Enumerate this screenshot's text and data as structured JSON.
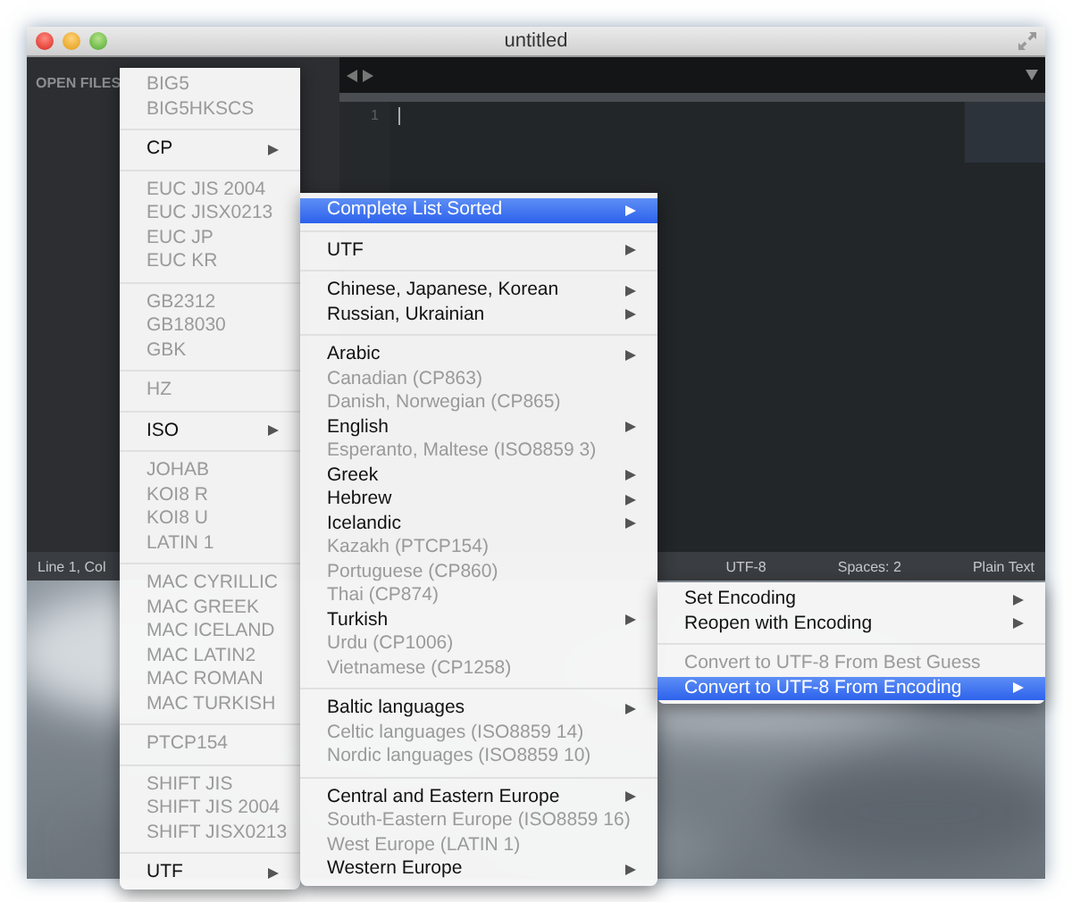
{
  "window": {
    "title": "untitled",
    "sidebar": {
      "header": "OPEN FILES"
    },
    "editor": {
      "line_numbers": [
        "1"
      ]
    },
    "status_bar": {
      "position": "Line 1, Col",
      "encoding": "UTF-8",
      "indentation": "Spaces: 2",
      "syntax": "Plain Text"
    }
  },
  "menus": [
    {
      "groups": [
        {
          "items": [
            {
              "label": "BIG5",
              "disabled": true,
              "submenu": false,
              "selected": false
            },
            {
              "label": "BIG5HKSCS",
              "disabled": true,
              "submenu": false,
              "selected": false
            }
          ]
        },
        {
          "items": [
            {
              "label": "CP",
              "disabled": false,
              "submenu": true,
              "selected": false
            }
          ]
        },
        {
          "items": [
            {
              "label": "EUC JIS 2004",
              "disabled": true,
              "submenu": false,
              "selected": false
            },
            {
              "label": "EUC JISX0213",
              "disabled": true,
              "submenu": false,
              "selected": false
            },
            {
              "label": "EUC JP",
              "disabled": true,
              "submenu": false,
              "selected": false
            },
            {
              "label": "EUC KR",
              "disabled": true,
              "submenu": false,
              "selected": false
            }
          ]
        },
        {
          "items": [
            {
              "label": "GB2312",
              "disabled": true,
              "submenu": false,
              "selected": false
            },
            {
              "label": "GB18030",
              "disabled": true,
              "submenu": false,
              "selected": false
            },
            {
              "label": "GBK",
              "disabled": true,
              "submenu": false,
              "selected": false
            }
          ]
        },
        {
          "items": [
            {
              "label": "HZ",
              "disabled": true,
              "submenu": false,
              "selected": false
            }
          ]
        },
        {
          "items": [
            {
              "label": "ISO",
              "disabled": false,
              "submenu": true,
              "selected": false
            }
          ]
        },
        {
          "items": [
            {
              "label": "JOHAB",
              "disabled": true,
              "submenu": false,
              "selected": false
            },
            {
              "label": "KOI8 R",
              "disabled": true,
              "submenu": false,
              "selected": false
            },
            {
              "label": "KOI8 U",
              "disabled": true,
              "submenu": false,
              "selected": false
            },
            {
              "label": "LATIN 1",
              "disabled": true,
              "submenu": false,
              "selected": false
            }
          ]
        },
        {
          "items": [
            {
              "label": "MAC CYRILLIC",
              "disabled": true,
              "submenu": false,
              "selected": false
            },
            {
              "label": "MAC GREEK",
              "disabled": true,
              "submenu": false,
              "selected": false
            },
            {
              "label": "MAC ICELAND",
              "disabled": true,
              "submenu": false,
              "selected": false
            },
            {
              "label": "MAC LATIN2",
              "disabled": true,
              "submenu": false,
              "selected": false
            },
            {
              "label": "MAC ROMAN",
              "disabled": true,
              "submenu": false,
              "selected": false
            },
            {
              "label": "MAC TURKISH",
              "disabled": true,
              "submenu": false,
              "selected": false
            }
          ]
        },
        {
          "items": [
            {
              "label": "PTCP154",
              "disabled": true,
              "submenu": false,
              "selected": false
            }
          ]
        },
        {
          "items": [
            {
              "label": "SHIFT JIS",
              "disabled": true,
              "submenu": false,
              "selected": false
            },
            {
              "label": "SHIFT JIS 2004",
              "disabled": true,
              "submenu": false,
              "selected": false
            },
            {
              "label": "SHIFT JISX0213",
              "disabled": true,
              "submenu": false,
              "selected": false
            }
          ]
        },
        {
          "items": [
            {
              "label": "UTF",
              "disabled": false,
              "submenu": true,
              "selected": false
            }
          ]
        }
      ]
    },
    {
      "groups": [
        {
          "items": [
            {
              "label": "Complete List Sorted",
              "disabled": false,
              "submenu": true,
              "selected": true
            }
          ]
        },
        {
          "items": [
            {
              "label": "UTF",
              "disabled": false,
              "submenu": true,
              "selected": false
            }
          ]
        },
        {
          "items": [
            {
              "label": "Chinese, Japanese, Korean",
              "disabled": false,
              "submenu": true,
              "selected": false
            },
            {
              "label": "Russian, Ukrainian",
              "disabled": false,
              "submenu": true,
              "selected": false
            }
          ]
        },
        {
          "items": [
            {
              "label": "Arabic",
              "disabled": false,
              "submenu": true,
              "selected": false
            },
            {
              "label": "Canadian (CP863)",
              "disabled": true,
              "submenu": false,
              "selected": false
            },
            {
              "label": "Danish, Norwegian (CP865)",
              "disabled": true,
              "submenu": false,
              "selected": false
            },
            {
              "label": "English",
              "disabled": false,
              "submenu": true,
              "selected": false
            },
            {
              "label": "Esperanto, Maltese (ISO8859 3)",
              "disabled": true,
              "submenu": false,
              "selected": false
            },
            {
              "label": "Greek",
              "disabled": false,
              "submenu": true,
              "selected": false
            },
            {
              "label": "Hebrew",
              "disabled": false,
              "submenu": true,
              "selected": false
            },
            {
              "label": "Icelandic",
              "disabled": false,
              "submenu": true,
              "selected": false
            },
            {
              "label": "Kazakh (PTCP154)",
              "disabled": true,
              "submenu": false,
              "selected": false
            },
            {
              "label": "Portuguese (CP860)",
              "disabled": true,
              "submenu": false,
              "selected": false
            },
            {
              "label": "Thai (CP874)",
              "disabled": true,
              "submenu": false,
              "selected": false
            },
            {
              "label": "Turkish",
              "disabled": false,
              "submenu": true,
              "selected": false
            },
            {
              "label": "Urdu (CP1006)",
              "disabled": true,
              "submenu": false,
              "selected": false
            },
            {
              "label": "Vietnamese (CP1258)",
              "disabled": true,
              "submenu": false,
              "selected": false
            }
          ]
        },
        {
          "items": [
            {
              "label": "Baltic languages",
              "disabled": false,
              "submenu": true,
              "selected": false
            },
            {
              "label": "Celtic languages (ISO8859 14)",
              "disabled": true,
              "submenu": false,
              "selected": false
            },
            {
              "label": "Nordic languages (ISO8859 10)",
              "disabled": true,
              "submenu": false,
              "selected": false
            }
          ]
        },
        {
          "items": [
            {
              "label": "Central and Eastern Europe",
              "disabled": false,
              "submenu": true,
              "selected": false
            },
            {
              "label": "South-Eastern Europe (ISO8859 16)",
              "disabled": true,
              "submenu": false,
              "selected": false
            },
            {
              "label": "West Europe (LATIN 1)",
              "disabled": true,
              "submenu": false,
              "selected": false
            },
            {
              "label": "Western Europe",
              "disabled": false,
              "submenu": true,
              "selected": false
            }
          ]
        }
      ]
    },
    {
      "groups": [
        {
          "items": [
            {
              "label": "Set Encoding",
              "disabled": false,
              "submenu": true,
              "selected": false
            },
            {
              "label": "Reopen with Encoding",
              "disabled": false,
              "submenu": true,
              "selected": false
            }
          ]
        },
        {
          "items": [
            {
              "label": "Convert to UTF-8 From Best Guess",
              "disabled": true,
              "submenu": false,
              "selected": false
            },
            {
              "label": "Convert to UTF-8 From Encoding",
              "disabled": false,
              "submenu": true,
              "selected": true
            }
          ]
        }
      ]
    }
  ]
}
